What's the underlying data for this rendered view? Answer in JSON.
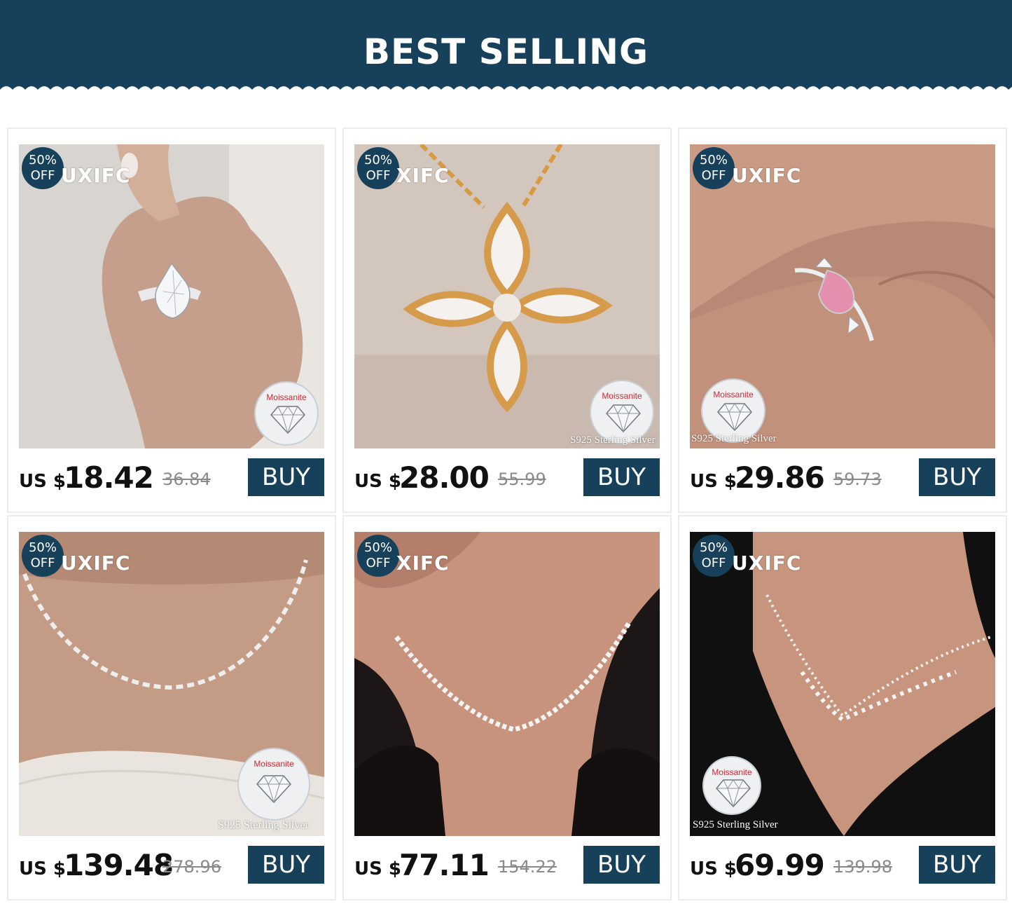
{
  "banner": {
    "title": "BEST SELLING"
  },
  "colors": {
    "brand_navy": "#17405a",
    "strike_gray": "#8a8a8a"
  },
  "badge": {
    "percent": "50%",
    "off": "OFF"
  },
  "seal_text": "Moissanite",
  "silver_text": "S925 Sterling Silver",
  "buy_label": "BUY",
  "currency_label": "US $",
  "products": [
    {
      "brand": "UXIFC",
      "price": "18.42",
      "old_price": "36.84",
      "icon": "pear-diamond-ring-photo"
    },
    {
      "brand": "XIFC",
      "price": "28.00",
      "old_price": "55.99",
      "icon": "clover-pendant-photo"
    },
    {
      "brand": "UXIFC",
      "price": "29.86",
      "old_price": "59.73",
      "icon": "pink-diamond-ring-photo"
    },
    {
      "brand": "UXIFC",
      "price": "139.48",
      "old_price": "278.96",
      "icon": "marquise-necklace-photo"
    },
    {
      "brand": "XIFC",
      "price": "77.11",
      "old_price": "154.22",
      "icon": "tennis-necklace-photo"
    },
    {
      "brand": "UXIFC",
      "price": "69.99",
      "old_price": "139.98",
      "icon": "drop-necklace-photo"
    }
  ]
}
